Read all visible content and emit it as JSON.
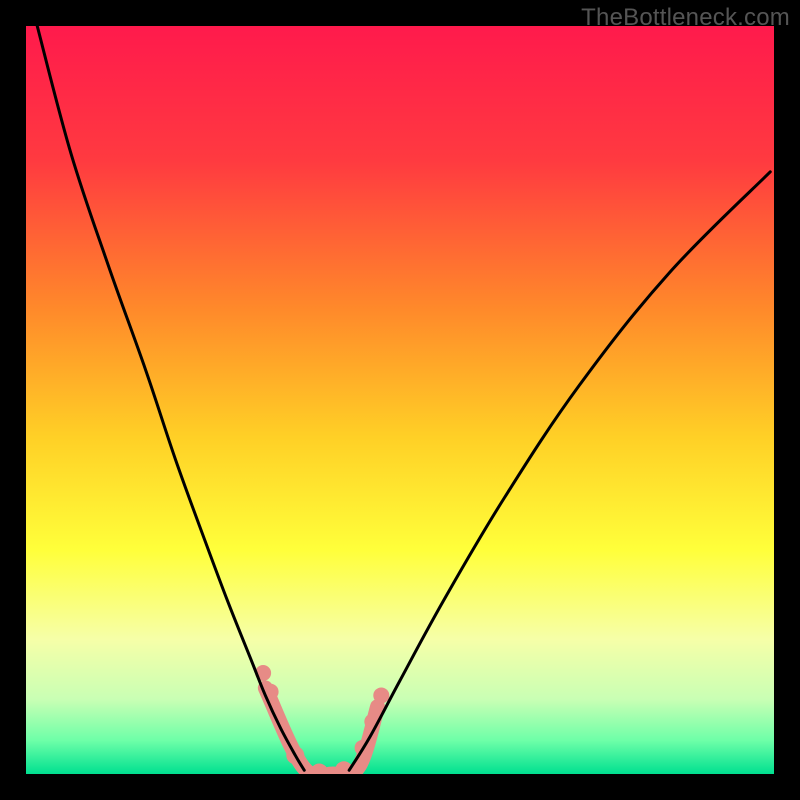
{
  "watermark": {
    "text": "TheBottleneck.com"
  },
  "chart_data": {
    "type": "line",
    "title": "",
    "xlabel": "",
    "ylabel": "",
    "xlim": [
      0,
      1
    ],
    "ylim": [
      0,
      1
    ],
    "grid": false,
    "legend": false,
    "gradient_stops": [
      {
        "offset": 0.0,
        "color": "#ff1a4c"
      },
      {
        "offset": 0.18,
        "color": "#ff3a40"
      },
      {
        "offset": 0.38,
        "color": "#ff8a2a"
      },
      {
        "offset": 0.55,
        "color": "#ffd026"
      },
      {
        "offset": 0.7,
        "color": "#ffff3a"
      },
      {
        "offset": 0.82,
        "color": "#f6ffa8"
      },
      {
        "offset": 0.9,
        "color": "#c9ffb4"
      },
      {
        "offset": 0.955,
        "color": "#6effa8"
      },
      {
        "offset": 1.0,
        "color": "#00e090"
      }
    ],
    "series": [
      {
        "name": "left-curve",
        "x": [
          0.015,
          0.06,
          0.11,
          0.16,
          0.2,
          0.24,
          0.27,
          0.3,
          0.32,
          0.34,
          0.36,
          0.372
        ],
        "values": [
          1.0,
          0.83,
          0.68,
          0.54,
          0.42,
          0.31,
          0.23,
          0.155,
          0.105,
          0.062,
          0.025,
          0.005
        ]
      },
      {
        "name": "right-curve",
        "x": [
          0.432,
          0.46,
          0.5,
          0.56,
          0.64,
          0.74,
          0.86,
          0.995
        ],
        "values": [
          0.005,
          0.05,
          0.125,
          0.235,
          0.37,
          0.52,
          0.67,
          0.805
        ]
      },
      {
        "name": "dumbbell-trace",
        "x": [
          0.32,
          0.37,
          0.41,
          0.445,
          0.47
        ],
        "values": [
          0.115,
          0.01,
          0.0,
          0.01,
          0.09
        ]
      }
    ],
    "markers": [
      {
        "x": 0.317,
        "y": 0.135,
        "r": 8
      },
      {
        "x": 0.327,
        "y": 0.11,
        "r": 8
      },
      {
        "x": 0.36,
        "y": 0.025,
        "r": 9
      },
      {
        "x": 0.392,
        "y": 0.002,
        "r": 9
      },
      {
        "x": 0.425,
        "y": 0.005,
        "r": 9
      },
      {
        "x": 0.45,
        "y": 0.035,
        "r": 8
      },
      {
        "x": 0.463,
        "y": 0.07,
        "r": 8
      },
      {
        "x": 0.475,
        "y": 0.105,
        "r": 8
      }
    ],
    "marker_fill": "#e78b86",
    "curve_stroke": "#000000",
    "trace_stroke": "#e78b86"
  }
}
